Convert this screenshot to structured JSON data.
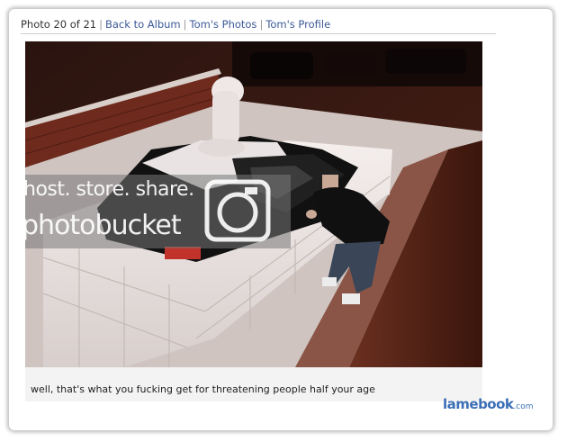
{
  "nav": {
    "photo_counter": "Photo 20 of 21",
    "separator": "|",
    "links": [
      "Back to Album",
      "Tom's Photos",
      "Tom's Profile"
    ]
  },
  "photo": {
    "watermark_line1": "host. store. share.",
    "watermark_line2": "photobucket"
  },
  "caption": "well, that's what you fucking get for threatening people half your age",
  "brand": {
    "name": "lamebook",
    "suffix": ".com"
  },
  "colors": {
    "link": "#3b5998",
    "brand": "#3b6fb6",
    "caption_bg": "#f3f3f3"
  }
}
